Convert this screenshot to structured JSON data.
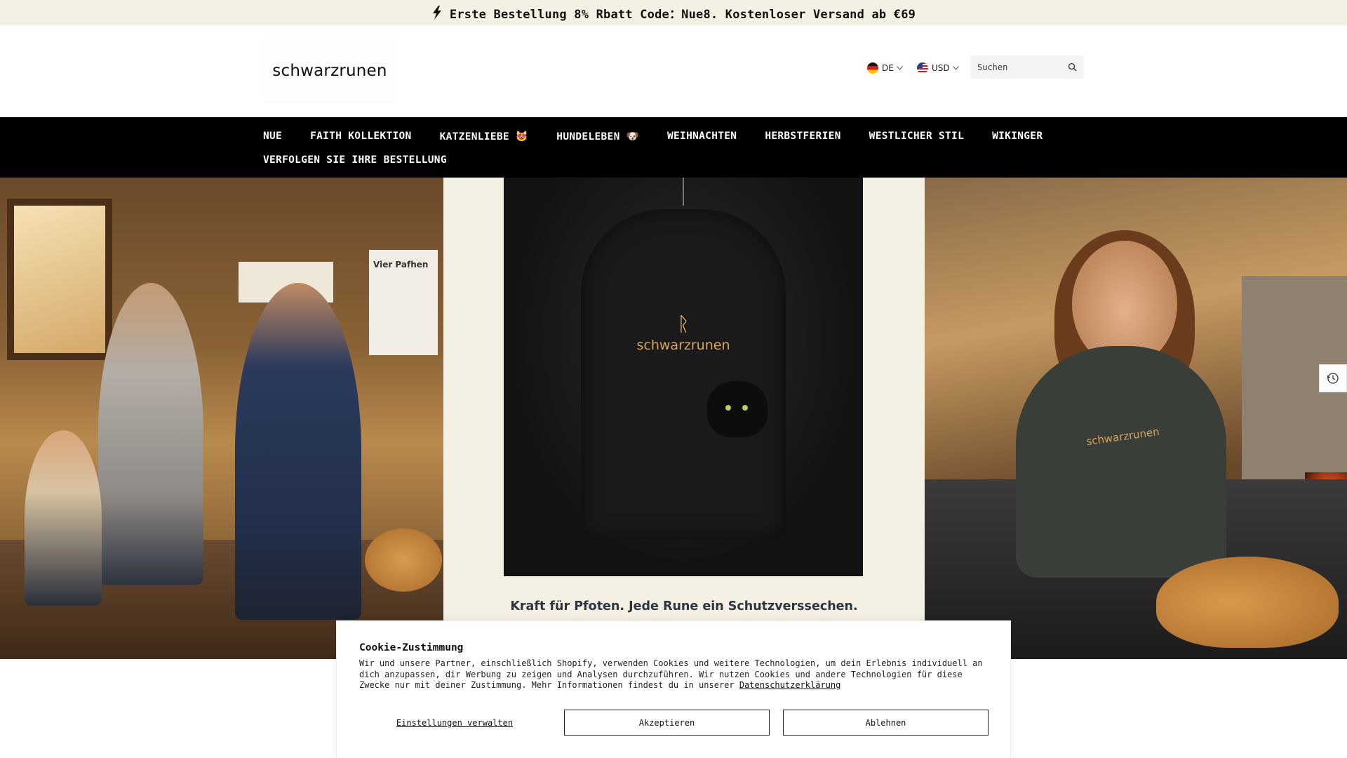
{
  "announcement": {
    "icon": "lightning-bolt-icon",
    "text": "Erste Bestellung 8% Rbatt Code：Nue8. Kostenloser Versand ab €69"
  },
  "header": {
    "logo_text": "schwarzrunen",
    "language": {
      "code": "DE",
      "flag": "germany-flag-icon"
    },
    "currency": {
      "code": "USD",
      "flag": "usa-flag-icon"
    },
    "search": {
      "placeholder": "Suchen",
      "icon": "search-icon"
    }
  },
  "nav": {
    "row1": [
      {
        "label": "NUE"
      },
      {
        "label": "FAITH KOLLEKTION"
      },
      {
        "label": "KATZENLIEBE 😻"
      },
      {
        "label": "HUNDELEBEN 🐶"
      },
      {
        "label": "WEIHNACHTEN"
      },
      {
        "label": "HERBSTFERIEN"
      },
      {
        "label": "WESTLICHER STIL"
      },
      {
        "label": "WIKINGER"
      }
    ],
    "row2": [
      {
        "label": "VERFOLGEN SIE IHRE BESTELLUNG"
      }
    ]
  },
  "hero": {
    "center_caption": "Kraft für Pfoten. Jede Rune ein Schutzverssechen.",
    "hoodie_brand": "schwarzrunen",
    "hoodie_rune": "ᚱ",
    "left_poster_text": "Vier Pafhen",
    "right_print": "schwarzrunen"
  },
  "side_button": {
    "icon": "history-icon"
  },
  "cookie": {
    "title": "Cookie-Zustimmung",
    "text": "Wir und unsere Partner, einschließlich Shopify, verwenden Cookies und weitere Technologien, um dein Erlebnis individuell an dich anzupassen, dir Werbung zu zeigen und Analysen durchzuführen. Wir nutzen Cookies und andere Technologien für diese Zwecke nur mit deiner Zustimmung. Mehr Informationen findest du in unserer ",
    "link": "Datenschutzerklärung",
    "manage_label": "Einstellungen verwalten",
    "accept_label": "Akzeptieren",
    "decline_label": "Ablehnen"
  },
  "colors": {
    "announcement_bg": "#f3f1e4",
    "nav_bg": "#000000",
    "hero_center_bg": "#f4f0e4",
    "hoodie_accent": "#d8a75a"
  }
}
